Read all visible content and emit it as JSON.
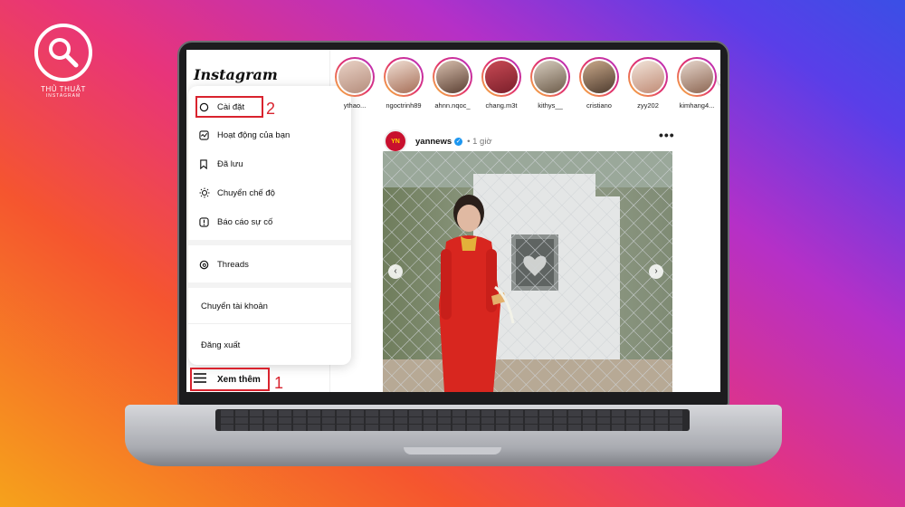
{
  "logo": {
    "line1": "THỦ THUẬT",
    "line2": "INSTAGRAM"
  },
  "app": {
    "brand": "Instagram"
  },
  "menu": {
    "items": [
      {
        "label": "Cài đặt",
        "icon": "settings-icon"
      },
      {
        "label": "Hoạt động của bạn",
        "icon": "activity-icon"
      },
      {
        "label": "Đã lưu",
        "icon": "bookmark-icon"
      },
      {
        "label": "Chuyển chế độ",
        "icon": "sun-icon"
      },
      {
        "label": "Báo cáo sự cố",
        "icon": "report-icon"
      }
    ],
    "threads": "Threads",
    "switch_account": "Chuyển tài khoản",
    "logout": "Đăng xuất"
  },
  "more": {
    "label": "Xem thêm",
    "icon": "hamburger-icon"
  },
  "annotations": {
    "step1": "1",
    "step2": "2"
  },
  "stories": [
    {
      "name": "ythao..."
    },
    {
      "name": "ngoctrinh89"
    },
    {
      "name": "ahnn.nqoc_"
    },
    {
      "name": "chang.m3t"
    },
    {
      "name": "kithys__"
    },
    {
      "name": "cristiano"
    },
    {
      "name": "zyy202"
    },
    {
      "name": "kimhang4..."
    }
  ],
  "post": {
    "username": "yannews",
    "time": "1 giờ",
    "more": "•••"
  },
  "colors": {
    "highlight": "#d9232e",
    "story_ring": "#e0306e",
    "verified": "#1c96f0"
  }
}
